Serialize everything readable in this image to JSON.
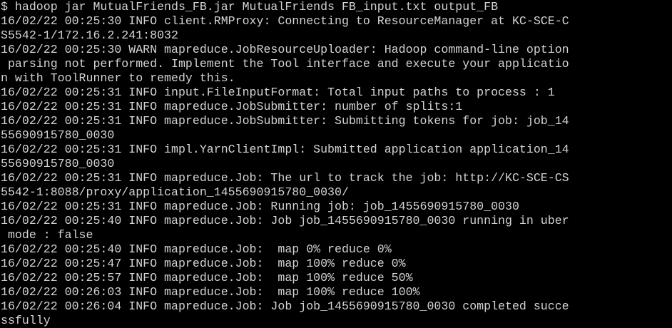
{
  "terminal": {
    "colors": {
      "background": "#000000",
      "foreground": "#d3d3d3"
    },
    "lines": [
      "$ hadoop jar MutualFriends_FB.jar MutualFriends FB_input.txt output_FB",
      "16/02/22 00:25:30 INFO client.RMProxy: Connecting to ResourceManager at KC-SCE-C",
      "S5542-1/172.16.2.241:8032",
      "16/02/22 00:25:30 WARN mapreduce.JobResourceUploader: Hadoop command-line option",
      " parsing not performed. Implement the Tool interface and execute your applicatio",
      "n with ToolRunner to remedy this.",
      "16/02/22 00:25:31 INFO input.FileInputFormat: Total input paths to process : 1",
      "16/02/22 00:25:31 INFO mapreduce.JobSubmitter: number of splits:1",
      "16/02/22 00:25:31 INFO mapreduce.JobSubmitter: Submitting tokens for job: job_14",
      "55690915780_0030",
      "16/02/22 00:25:31 INFO impl.YarnClientImpl: Submitted application application_14",
      "55690915780_0030",
      "16/02/22 00:25:31 INFO mapreduce.Job: The url to track the job: http://KC-SCE-CS",
      "5542-1:8088/proxy/application_1455690915780_0030/",
      "16/02/22 00:25:31 INFO mapreduce.Job: Running job: job_1455690915780_0030",
      "16/02/22 00:25:40 INFO mapreduce.Job: Job job_1455690915780_0030 running in uber",
      " mode : false",
      "16/02/22 00:25:40 INFO mapreduce.Job:  map 0% reduce 0%",
      "16/02/22 00:25:47 INFO mapreduce.Job:  map 100% reduce 0%",
      "16/02/22 00:25:57 INFO mapreduce.Job:  map 100% reduce 50%",
      "16/02/22 00:26:03 INFO mapreduce.Job:  map 100% reduce 100%",
      "16/02/22 00:26:04 INFO mapreduce.Job: Job job_1455690915780_0030 completed succe",
      "ssfully"
    ]
  }
}
